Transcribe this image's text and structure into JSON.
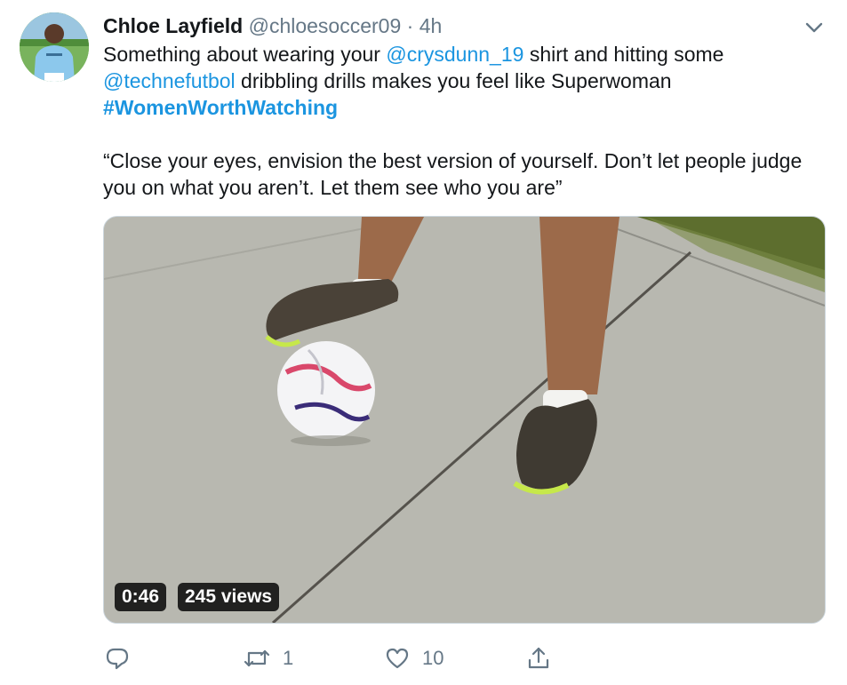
{
  "tweet": {
    "author_name": "Chloe Layfield",
    "author_handle": "@chloesoccer09",
    "separator": "·",
    "time": "4h",
    "text": {
      "line1_pre": "Something about wearing your ",
      "mention1": "@crysdunn_19",
      "line1_post": " shirt and hitting some",
      "mention2": "@technefutbol",
      "line2_post": " dribbling drills makes you feel like Superwoman",
      "hashtag": "#WomenWorthWatching",
      "quote": "“Close your eyes, envision the best version of yourself. Don’t let people judge you on what you aren’t. Let them see who you are”"
    },
    "video": {
      "duration": "0:46",
      "views": "245 views"
    },
    "actions": {
      "reply_count": "",
      "retweet_count": "1",
      "like_count": "10"
    }
  },
  "icons": {
    "menu": "chevron-down-icon",
    "reply": "reply-icon",
    "retweet": "retweet-icon",
    "like": "heart-icon",
    "share": "share-icon"
  },
  "colors": {
    "link": "#1b95e0",
    "secondary_text": "#657786",
    "primary_text": "#14171a"
  }
}
